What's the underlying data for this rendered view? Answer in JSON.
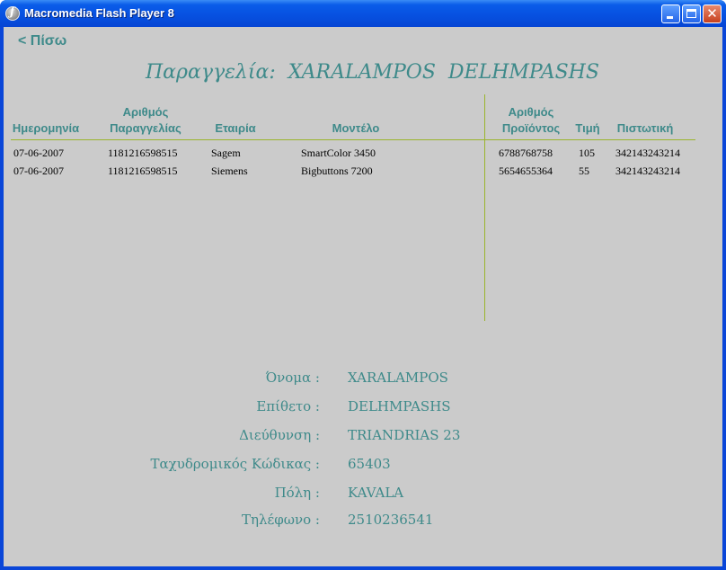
{
  "window": {
    "title": "Macromedia Flash Player 8",
    "controls": {
      "minimize_icon": "minimize-icon",
      "maximize_icon": "maximize-icon",
      "close_icon": "close-icon",
      "close_glyph": "✕"
    }
  },
  "back": {
    "label": "< Πίσω"
  },
  "order": {
    "title": "Παραγγελία:  XARALAMPOS  DELHMPASHS"
  },
  "table": {
    "headers": {
      "date": "Ημερομηνία",
      "order_no_1": "Αριθμός",
      "order_no_2": "Παραγγελίας",
      "company": "Εταιρία",
      "model": "Μοντέλο",
      "product_no_1": "Αριθμός",
      "product_no_2": "Προϊόντος",
      "price": "Τιμή",
      "credit": "Πιστωτική"
    },
    "rows": [
      {
        "date": "07-06-2007",
        "order_no": "1181216598515",
        "company": "Sagem",
        "model": "SmartColor 3450",
        "product_no": "6788768758",
        "price": "105",
        "credit": "342143243214"
      },
      {
        "date": "07-06-2007",
        "order_no": "1181216598515",
        "company": "Siemens",
        "model": "Bigbuttons 7200",
        "product_no": "5654655364",
        "price": "55",
        "credit": "342143243214"
      }
    ]
  },
  "customer": {
    "fields": [
      {
        "label": "Όνομα :",
        "value": "XARALAMPOS"
      },
      {
        "label": "Επίθετο :",
        "value": "DELHMPASHS"
      },
      {
        "label": "Διεύθυνση :",
        "value": "TRIANDRIAS 23"
      },
      {
        "label": "Ταχυδρομικός Κώδικας :",
        "value": "65403"
      },
      {
        "label": "Πόλη :",
        "value": "KAVALA"
      },
      {
        "label": "Τηλέφωνο :",
        "value": "2510236541"
      }
    ]
  },
  "colors": {
    "accent": "#3e8a8a",
    "divider": "#9ab52c",
    "background": "#cbcbcb",
    "titlebar": "#0a5ce9"
  }
}
